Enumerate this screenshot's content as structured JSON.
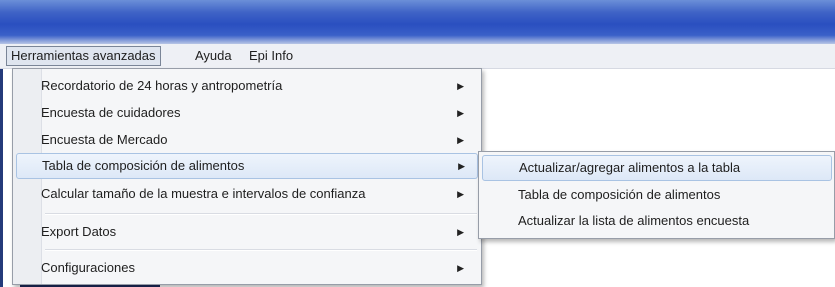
{
  "menubar": {
    "items": [
      {
        "label": "Herramientas avanzadas",
        "active": true
      },
      {
        "label": "Ayuda"
      },
      {
        "label": "Epi Info"
      }
    ]
  },
  "main_menu": {
    "items": [
      {
        "label": "Recordatorio de 24 horas y antropometría",
        "has_submenu": true
      },
      {
        "label": "Encuesta de cuidadores",
        "has_submenu": true
      },
      {
        "label": "Encuesta de Mercado",
        "has_submenu": true
      },
      {
        "label": "Tabla de composición de alimentos",
        "has_submenu": true,
        "highlighted": true
      },
      {
        "label": "Calcular tamaño de la muestra e intervalos de confianza",
        "has_submenu": true
      },
      {
        "label": "Export Datos",
        "has_submenu": true
      },
      {
        "label": "Configuraciones",
        "has_submenu": true
      }
    ]
  },
  "submenu": {
    "items": [
      {
        "label": "Actualizar/agregar alimentos a la tabla",
        "highlighted": true
      },
      {
        "label": "Tabla de composición de alimentos"
      },
      {
        "label": "Actualizar la lista de alimentos encuesta"
      }
    ]
  },
  "icons": {
    "submenu_arrow": "chevron-right-icon"
  },
  "colors": {
    "titlebar": "#2a4fc0",
    "menu_bg": "#f5f6f8",
    "highlight": "#dde8f7",
    "highlight_border": "#a9c3e3"
  }
}
